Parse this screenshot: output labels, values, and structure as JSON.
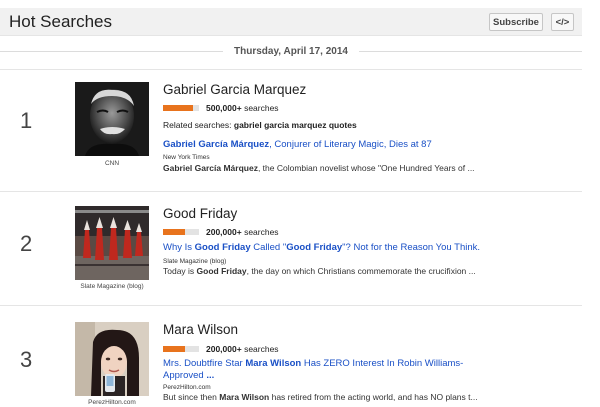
{
  "header": {
    "title": "Hot Searches",
    "subscribe_label": "Subscribe",
    "embed_label": "</>"
  },
  "date": "Thursday, April 17, 2014",
  "trends": [
    {
      "rank": "1",
      "title": "Gabriel Garcia Marquez",
      "search_count": "500,000+",
      "searches_suffix": " searches",
      "volume_fraction": 0.83,
      "image_source": "CNN",
      "related_label": "Related searches: ",
      "related_terms": "gabriel garcia marquez quotes",
      "article_title_parts": [
        {
          "text": "Gabriel García Márquez",
          "bold": true
        },
        {
          "text": ", Conjurer of Literary Magic, Dies at 87",
          "bold": false
        }
      ],
      "article_source": "New York Times",
      "snippet_parts": [
        {
          "text": "Gabriel García Márquez",
          "bold": true
        },
        {
          "text": ", the Colombian novelist whose \"One Hundred Years of ...",
          "bold": false
        }
      ]
    },
    {
      "rank": "2",
      "title": "Good Friday",
      "search_count": "200,000+",
      "searches_suffix": " searches",
      "volume_fraction": 0.6,
      "image_source": "Slate Magazine (blog)",
      "article_title_parts": [
        {
          "text": "Why Is ",
          "bold": false
        },
        {
          "text": "Good Friday",
          "bold": true
        },
        {
          "text": " Called \"",
          "bold": false
        },
        {
          "text": "Good Friday",
          "bold": true
        },
        {
          "text": "\"? Not for the Reason You Think.",
          "bold": false
        }
      ],
      "article_source": "Slate Magazine (blog)",
      "snippet_parts": [
        {
          "text": "Today is ",
          "bold": false
        },
        {
          "text": "Good Friday",
          "bold": true
        },
        {
          "text": ", the day on which Christians commemorate the crucifixion ...",
          "bold": false
        }
      ]
    },
    {
      "rank": "3",
      "title": "Mara Wilson",
      "search_count": "200,000+",
      "searches_suffix": " searches",
      "volume_fraction": 0.6,
      "image_source": "PerezHilton.com",
      "article_title_parts": [
        {
          "text": "Mrs. Doubtfire Star ",
          "bold": false
        },
        {
          "text": "Mara Wilson",
          "bold": true
        },
        {
          "text": " Has ZERO Interest In Robin Williams-Approved ",
          "bold": false
        },
        {
          "text": "...",
          "bold": true
        }
      ],
      "article_source": "PerezHilton.com",
      "snippet_parts": [
        {
          "text": "But since then ",
          "bold": false
        },
        {
          "text": "Mara Wilson",
          "bold": true
        },
        {
          "text": " has retired from the acting world, and has NO plans t...",
          "bold": false
        }
      ]
    }
  ],
  "colors": {
    "accent_bar": "#e8731d",
    "link": "#1a50c6"
  }
}
